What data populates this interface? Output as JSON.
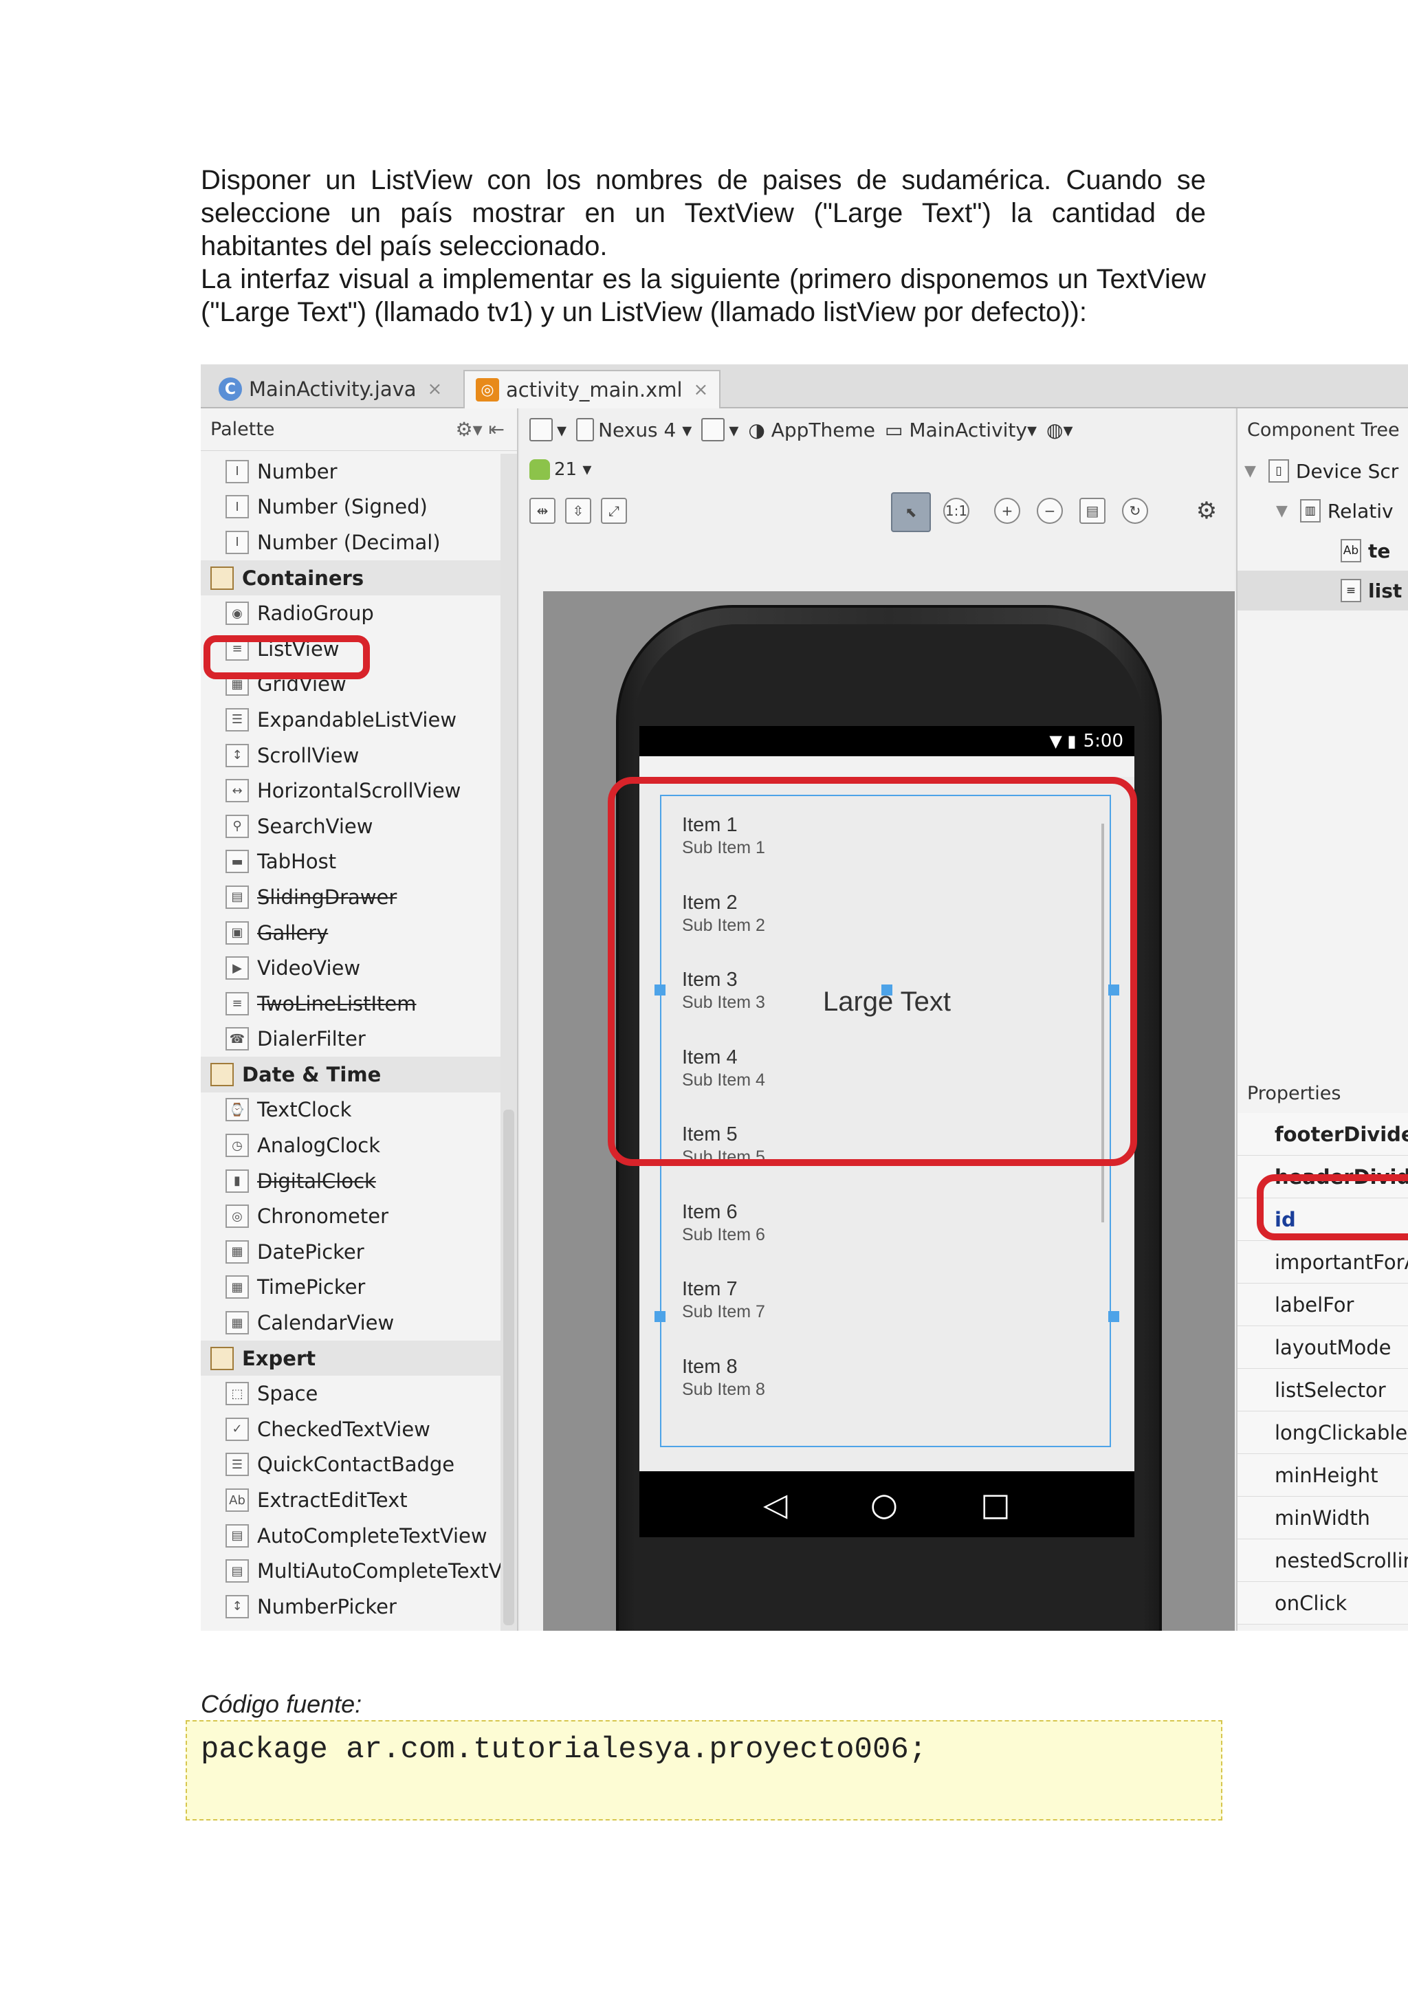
{
  "intro": {
    "paragraph1": "Disponer un ListView con los nombres de paises de sudamérica. Cuando se seleccione un país mostrar en un TextView (\"Large Text\") la cantidad de habitantes del país seleccionado.",
    "paragraph2": "La interfaz visual a implementar es la siguiente (primero disponemos un TextView (\"Large Text\") (llamado tv1) y un ListView (llamado listView por defecto)):"
  },
  "ide": {
    "tabs": [
      {
        "label": "MainActivity.java",
        "icon": "java-class-icon"
      },
      {
        "label": "activity_main.xml",
        "icon": "xml-layout-icon"
      }
    ],
    "palette": {
      "title": "Palette",
      "items": [
        {
          "label": "Number",
          "cat": false,
          "strike": false,
          "glyph": "I"
        },
        {
          "label": "Number (Signed)",
          "cat": false,
          "strike": false,
          "glyph": "I"
        },
        {
          "label": "Number (Decimal)",
          "cat": false,
          "strike": false,
          "glyph": "I"
        },
        {
          "label": "Containers",
          "cat": true,
          "strike": false,
          "glyph": ""
        },
        {
          "label": "RadioGroup",
          "cat": false,
          "strike": false,
          "glyph": "◉"
        },
        {
          "label": "ListView",
          "cat": false,
          "strike": false,
          "glyph": "≡"
        },
        {
          "label": "GridView",
          "cat": false,
          "strike": false,
          "glyph": "▦"
        },
        {
          "label": "ExpandableListView",
          "cat": false,
          "strike": false,
          "glyph": "☰"
        },
        {
          "label": "ScrollView",
          "cat": false,
          "strike": false,
          "glyph": "↕"
        },
        {
          "label": "HorizontalScrollView",
          "cat": false,
          "strike": false,
          "glyph": "↔"
        },
        {
          "label": "SearchView",
          "cat": false,
          "strike": false,
          "glyph": "⚲"
        },
        {
          "label": "TabHost",
          "cat": false,
          "strike": false,
          "glyph": "▬"
        },
        {
          "label": "SlidingDrawer",
          "cat": false,
          "strike": true,
          "glyph": "▤"
        },
        {
          "label": "Gallery",
          "cat": false,
          "strike": true,
          "glyph": "▣"
        },
        {
          "label": "VideoView",
          "cat": false,
          "strike": false,
          "glyph": "▶"
        },
        {
          "label": "TwoLineListItem",
          "cat": false,
          "strike": true,
          "glyph": "≡"
        },
        {
          "label": "DialerFilter",
          "cat": false,
          "strike": false,
          "glyph": "☎"
        },
        {
          "label": "Date & Time",
          "cat": true,
          "strike": false,
          "glyph": ""
        },
        {
          "label": "TextClock",
          "cat": false,
          "strike": false,
          "glyph": "⌚"
        },
        {
          "label": "AnalogClock",
          "cat": false,
          "strike": false,
          "glyph": "◷"
        },
        {
          "label": "DigitalClock",
          "cat": false,
          "strike": true,
          "glyph": "▮"
        },
        {
          "label": "Chronometer",
          "cat": false,
          "strike": false,
          "glyph": "◎"
        },
        {
          "label": "DatePicker",
          "cat": false,
          "strike": false,
          "glyph": "▦"
        },
        {
          "label": "TimePicker",
          "cat": false,
          "strike": false,
          "glyph": "▦"
        },
        {
          "label": "CalendarView",
          "cat": false,
          "strike": false,
          "glyph": "▦"
        },
        {
          "label": "Expert",
          "cat": true,
          "strike": false,
          "glyph": ""
        },
        {
          "label": "Space",
          "cat": false,
          "strike": false,
          "glyph": "⬚"
        },
        {
          "label": "CheckedTextView",
          "cat": false,
          "strike": false,
          "glyph": "✓"
        },
        {
          "label": "QuickContactBadge",
          "cat": false,
          "strike": false,
          "glyph": "☰"
        },
        {
          "label": "ExtractEditText",
          "cat": false,
          "strike": false,
          "glyph": "Ab"
        },
        {
          "label": "AutoCompleteTextView",
          "cat": false,
          "strike": false,
          "glyph": "▤"
        },
        {
          "label": "MultiAutoCompleteTextV",
          "cat": false,
          "strike": false,
          "glyph": "▤"
        },
        {
          "label": "NumberPicker",
          "cat": false,
          "strike": false,
          "glyph": "↕"
        }
      ]
    },
    "toolbar": {
      "device": "Nexus 4",
      "theme": "AppTheme",
      "activity": "MainActivity",
      "api": "21"
    },
    "phone": {
      "time": "5:00",
      "large_text": "Large Text",
      "list_items": [
        {
          "title": "Item 1",
          "sub": "Sub Item 1"
        },
        {
          "title": "Item 2",
          "sub": "Sub Item 2"
        },
        {
          "title": "Item 3",
          "sub": "Sub Item 3"
        },
        {
          "title": "Item 4",
          "sub": "Sub Item 4"
        },
        {
          "title": "Item 5",
          "sub": "Sub Item 5"
        },
        {
          "title": "Item 6",
          "sub": "Sub Item 6"
        },
        {
          "title": "Item 7",
          "sub": "Sub Item 7"
        },
        {
          "title": "Item 8",
          "sub": "Sub Item 8"
        }
      ]
    },
    "component_tree": {
      "title": "Component Tree",
      "nodes": [
        {
          "label": "Device Scr",
          "glyph": "▯"
        },
        {
          "label": "Relativ",
          "glyph": "▥"
        },
        {
          "label": "te",
          "glyph": "Ab"
        },
        {
          "label": "list",
          "glyph": "≡"
        }
      ]
    },
    "properties": {
      "title": "Properties",
      "rows": [
        "footerDivider",
        "headerDivide",
        "id",
        "importantForA",
        "labelFor",
        "layoutMode",
        "listSelector",
        "longClickable",
        "minHeight",
        "minWidth",
        "nestedScrollin",
        "onClick"
      ]
    }
  },
  "caption": "Código fuente:",
  "code": "package ar.com.tutorialesya.proyecto006;",
  "colors": {
    "highlight": "#d8232a",
    "selection": "#4da3e8",
    "code_bg": "#fdfcd4"
  }
}
